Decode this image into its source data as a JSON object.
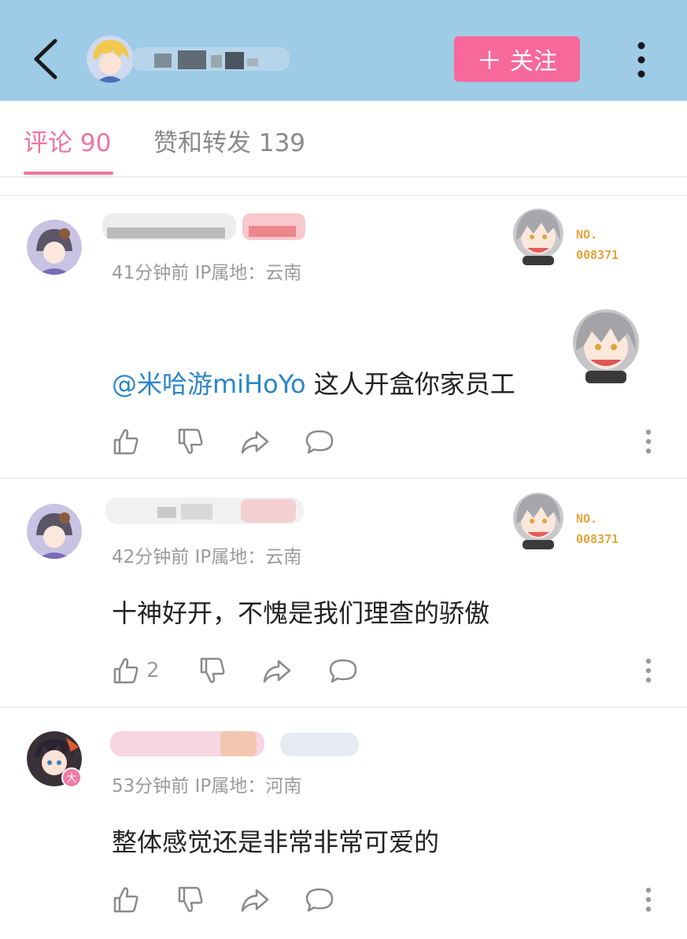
{
  "header": {
    "follow_label": "关注",
    "follow_color": "#f7699a",
    "bar_color": "#9ecbe6"
  },
  "tabs": [
    {
      "label": "评论 90",
      "active": true
    },
    {
      "label": "赞和转发 139",
      "active": false
    }
  ],
  "comments": [
    {
      "meta": "41分钟前  IP属地：云南",
      "mention": "@米哈游miHoYo",
      "text": " 这人开盒你家员工",
      "badge_no": "NO.",
      "badge_num": "008371",
      "has_sticker": true,
      "like_count": ""
    },
    {
      "meta": "42分钟前  IP属地：云南",
      "mention": "",
      "text": "十神好开，不愧是我们理查的骄傲",
      "badge_no": "NO.",
      "badge_num": "008371",
      "has_sticker": false,
      "like_count": "2"
    },
    {
      "meta": "53分钟前  IP属地：河南",
      "mention": "",
      "text": "整体感觉还是非常非常可爱的",
      "badge_no": "",
      "badge_num": "",
      "has_sticker": false,
      "like_count": ""
    }
  ],
  "icons": [
    "back-arrow-icon",
    "plus-icon",
    "more-vertical-icon",
    "like-icon",
    "dislike-icon",
    "share-icon",
    "comment-icon"
  ]
}
